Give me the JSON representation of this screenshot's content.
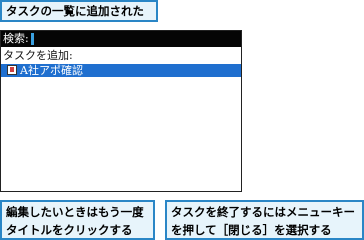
{
  "callouts": {
    "top": "タスクの一覧に追加された",
    "left": "編集したいときはもう一度\nタイトルをクリックする",
    "right": "タスクを終了するにはメニューキー\nを押して［閉じる］を選択する"
  },
  "screen": {
    "search_label": "検索:",
    "add_task_label": "タスクを追加:",
    "tasks": [
      {
        "title": "A社アポ確認",
        "icon": "task-note-icon"
      }
    ]
  },
  "colors": {
    "callout_bg": "#e7f4fb",
    "callout_border": "#2a86c6",
    "selection": "#1f6fcf",
    "search_bar": "#050505"
  }
}
